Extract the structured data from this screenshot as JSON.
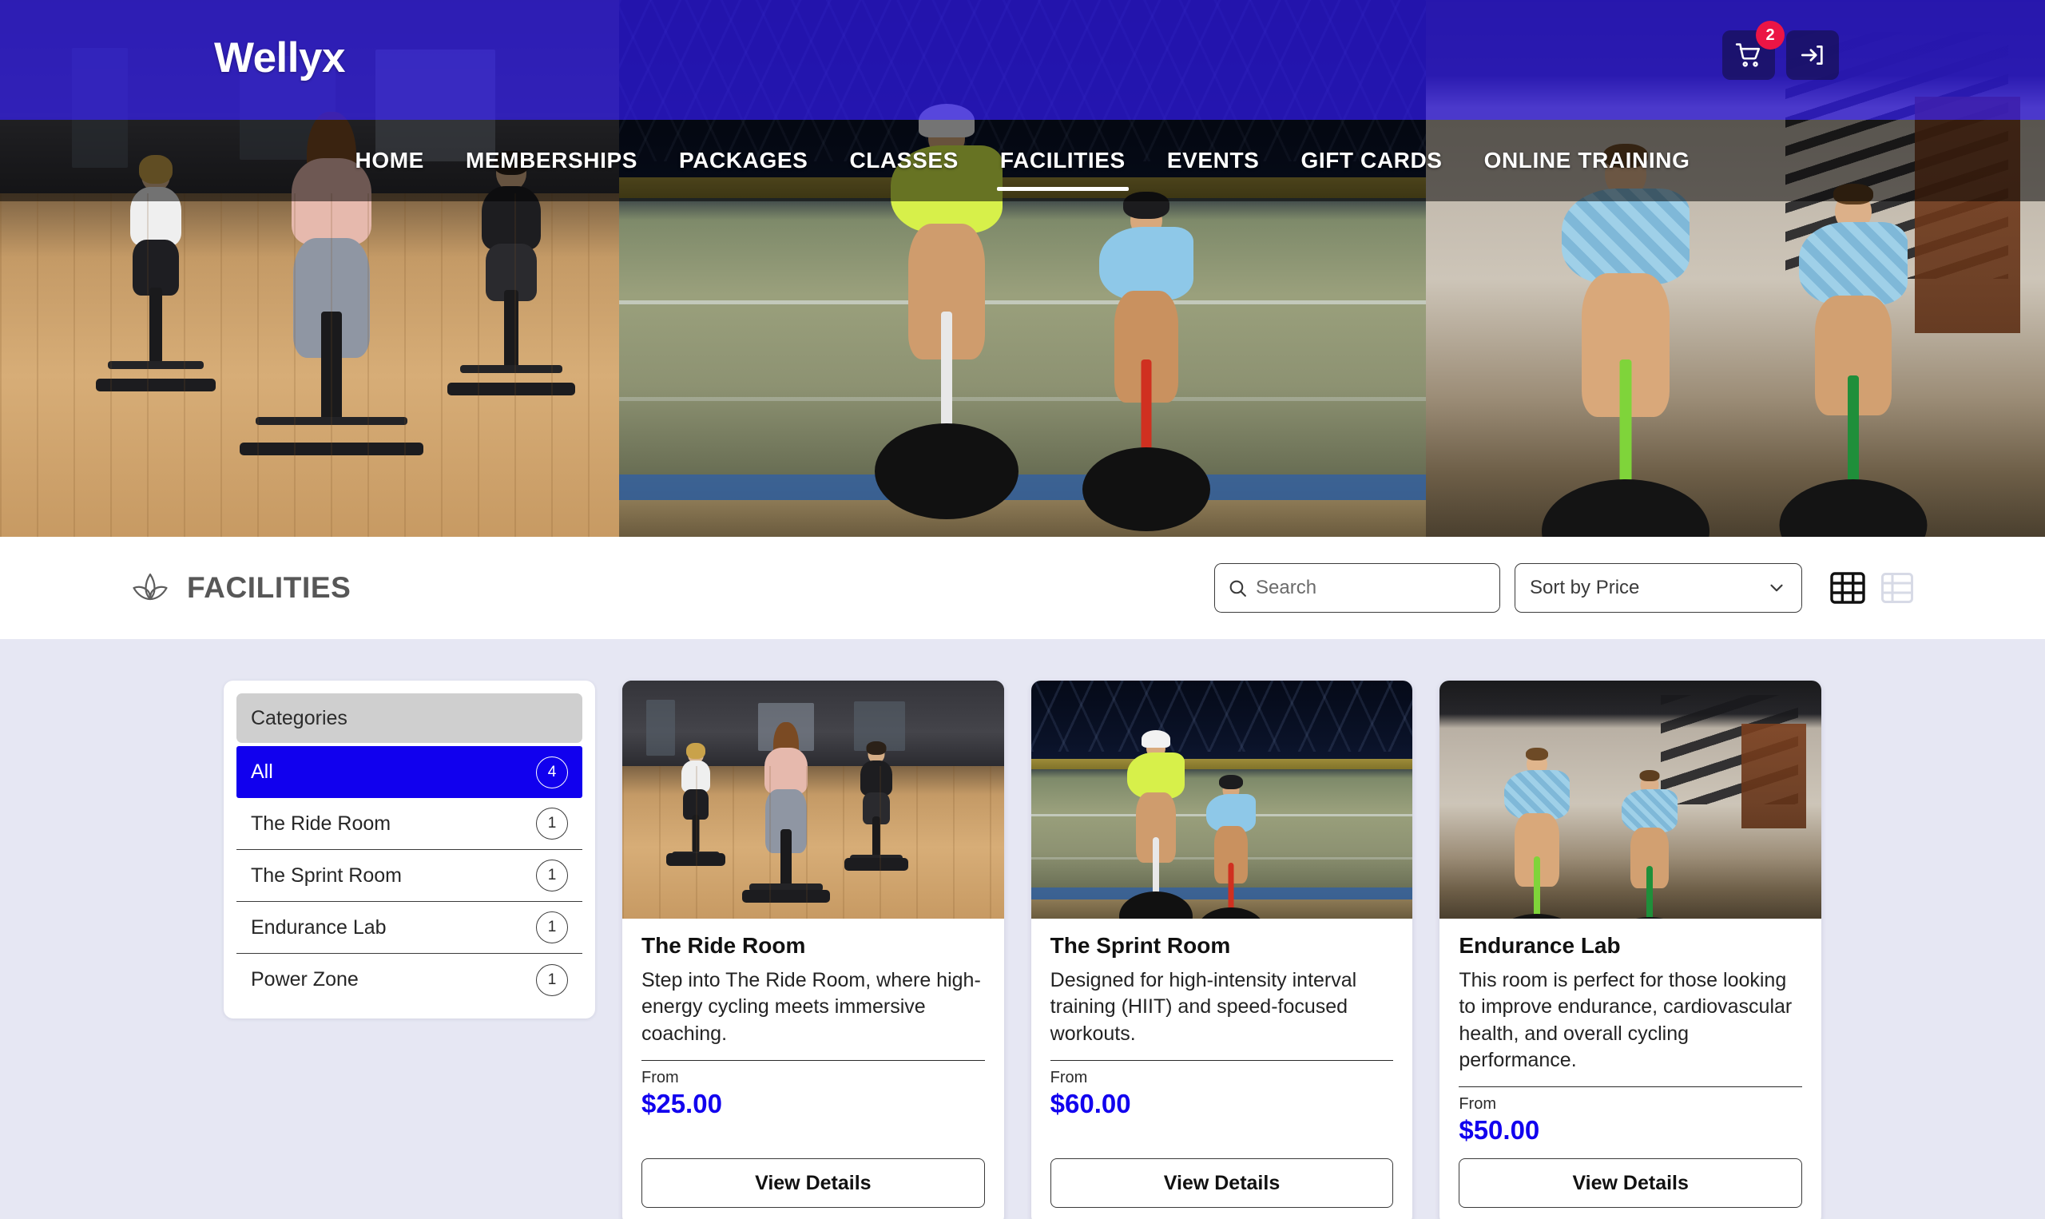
{
  "header": {
    "brand": "Wellyx",
    "cart_badge": "2",
    "cart_icon": "shopping-cart-icon",
    "login_icon": "sign-in-icon",
    "nav": [
      {
        "label": "HOME",
        "active": false
      },
      {
        "label": "MEMBERSHIPS",
        "active": false
      },
      {
        "label": "PACKAGES",
        "active": false
      },
      {
        "label": "CLASSES",
        "active": false
      },
      {
        "label": "FACILITIES",
        "active": true
      },
      {
        "label": "EVENTS",
        "active": false
      },
      {
        "label": "GIFT CARDS",
        "active": false
      },
      {
        "label": "ONLINE TRAINING",
        "active": false
      }
    ]
  },
  "toolbar": {
    "page_title": "FACILITIES",
    "title_icon": "lotus-icon",
    "search": {
      "icon": "search-icon",
      "value": "",
      "placeholder": "Search"
    },
    "sort": {
      "selected": "Sort by Price",
      "chevron_icon": "chevron-down-icon"
    },
    "views": [
      {
        "name": "grid-view",
        "icon": "grid-icon",
        "active": true
      },
      {
        "name": "list-view",
        "icon": "list-icon",
        "active": false
      }
    ]
  },
  "sidebar": {
    "header": "Categories",
    "items": [
      {
        "label": "All",
        "count": "4",
        "active": true
      },
      {
        "label": "The Ride Room",
        "count": "1",
        "active": false
      },
      {
        "label": "The Sprint Room",
        "count": "1",
        "active": false
      },
      {
        "label": "Endurance Lab",
        "count": "1",
        "active": false
      },
      {
        "label": "Power Zone",
        "count": "1",
        "active": false
      }
    ]
  },
  "cards": [
    {
      "title": "The Ride Room",
      "description": "Step into The Ride Room, where high-energy cycling meets immersive coaching.",
      "from_label": "From",
      "price": "$25.00",
      "button": "View Details",
      "image_alt": "indoor-spin-studio-photo"
    },
    {
      "title": "The Sprint Room",
      "description": "Designed for high-intensity interval training (HIIT) and speed-focused workouts.",
      "from_label": "From",
      "price": "$60.00",
      "button": "View Details",
      "image_alt": "velodrome-track-cyclists-photo"
    },
    {
      "title": "Endurance Lab",
      "description": "This room is perfect for those looking to improve endurance, cardiovascular health, and overall cycling performance.",
      "from_label": "From",
      "price": "$50.00",
      "button": "View Details",
      "image_alt": "indoor-trainer-cyclists-photo"
    }
  ],
  "colors": {
    "accent_blue": "#1100ee",
    "hero_overlay_blue": "#2b17d6",
    "badge_red": "#eb1545",
    "page_background": "#e6e7f3",
    "category_header_gray": "#cfcfcf"
  }
}
